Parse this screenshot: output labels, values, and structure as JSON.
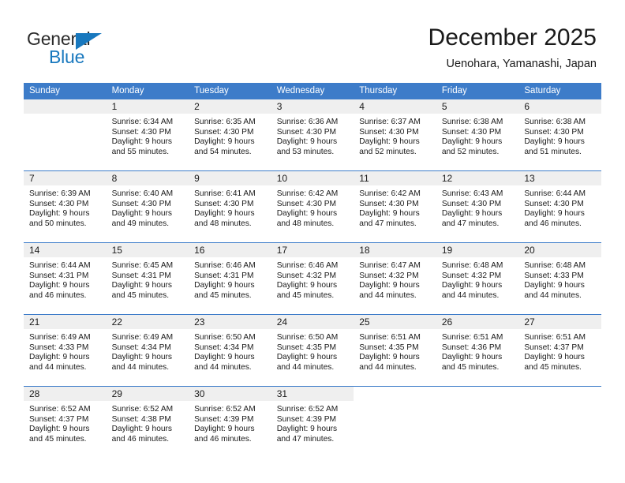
{
  "branding": {
    "logo_primary": "General",
    "logo_secondary": "Blue",
    "logo_triangle_color": "#1878be",
    "logo_primary_color": "#2b2b2b"
  },
  "header": {
    "title": "December 2025",
    "subtitle": "Uenohara, Yamanashi, Japan"
  },
  "theme": {
    "header_row_background": "#3d7cc9",
    "day_number_band_background": "#efefef",
    "grid_line_color": "#3d7cc9",
    "text_color": "#1a1a1a"
  },
  "calendar": {
    "weekday_headers": [
      "Sunday",
      "Monday",
      "Tuesday",
      "Wednesday",
      "Thursday",
      "Friday",
      "Saturday"
    ],
    "weeks": [
      [
        {
          "day": "",
          "lines": [],
          "blank": true,
          "leading_shade": true
        },
        {
          "day": "1",
          "lines": [
            "Sunrise: 6:34 AM",
            "Sunset: 4:30 PM",
            "Daylight: 9 hours",
            "and 55 minutes."
          ]
        },
        {
          "day": "2",
          "lines": [
            "Sunrise: 6:35 AM",
            "Sunset: 4:30 PM",
            "Daylight: 9 hours",
            "and 54 minutes."
          ]
        },
        {
          "day": "3",
          "lines": [
            "Sunrise: 6:36 AM",
            "Sunset: 4:30 PM",
            "Daylight: 9 hours",
            "and 53 minutes."
          ]
        },
        {
          "day": "4",
          "lines": [
            "Sunrise: 6:37 AM",
            "Sunset: 4:30 PM",
            "Daylight: 9 hours",
            "and 52 minutes."
          ]
        },
        {
          "day": "5",
          "lines": [
            "Sunrise: 6:38 AM",
            "Sunset: 4:30 PM",
            "Daylight: 9 hours",
            "and 52 minutes."
          ]
        },
        {
          "day": "6",
          "lines": [
            "Sunrise: 6:38 AM",
            "Sunset: 4:30 PM",
            "Daylight: 9 hours",
            "and 51 minutes."
          ]
        }
      ],
      [
        {
          "day": "7",
          "lines": [
            "Sunrise: 6:39 AM",
            "Sunset: 4:30 PM",
            "Daylight: 9 hours",
            "and 50 minutes."
          ]
        },
        {
          "day": "8",
          "lines": [
            "Sunrise: 6:40 AM",
            "Sunset: 4:30 PM",
            "Daylight: 9 hours",
            "and 49 minutes."
          ]
        },
        {
          "day": "9",
          "lines": [
            "Sunrise: 6:41 AM",
            "Sunset: 4:30 PM",
            "Daylight: 9 hours",
            "and 48 minutes."
          ]
        },
        {
          "day": "10",
          "lines": [
            "Sunrise: 6:42 AM",
            "Sunset: 4:30 PM",
            "Daylight: 9 hours",
            "and 48 minutes."
          ]
        },
        {
          "day": "11",
          "lines": [
            "Sunrise: 6:42 AM",
            "Sunset: 4:30 PM",
            "Daylight: 9 hours",
            "and 47 minutes."
          ]
        },
        {
          "day": "12",
          "lines": [
            "Sunrise: 6:43 AM",
            "Sunset: 4:30 PM",
            "Daylight: 9 hours",
            "and 47 minutes."
          ]
        },
        {
          "day": "13",
          "lines": [
            "Sunrise: 6:44 AM",
            "Sunset: 4:30 PM",
            "Daylight: 9 hours",
            "and 46 minutes."
          ]
        }
      ],
      [
        {
          "day": "14",
          "lines": [
            "Sunrise: 6:44 AM",
            "Sunset: 4:31 PM",
            "Daylight: 9 hours",
            "and 46 minutes."
          ]
        },
        {
          "day": "15",
          "lines": [
            "Sunrise: 6:45 AM",
            "Sunset: 4:31 PM",
            "Daylight: 9 hours",
            "and 45 minutes."
          ]
        },
        {
          "day": "16",
          "lines": [
            "Sunrise: 6:46 AM",
            "Sunset: 4:31 PM",
            "Daylight: 9 hours",
            "and 45 minutes."
          ]
        },
        {
          "day": "17",
          "lines": [
            "Sunrise: 6:46 AM",
            "Sunset: 4:32 PM",
            "Daylight: 9 hours",
            "and 45 minutes."
          ]
        },
        {
          "day": "18",
          "lines": [
            "Sunrise: 6:47 AM",
            "Sunset: 4:32 PM",
            "Daylight: 9 hours",
            "and 44 minutes."
          ]
        },
        {
          "day": "19",
          "lines": [
            "Sunrise: 6:48 AM",
            "Sunset: 4:32 PM",
            "Daylight: 9 hours",
            "and 44 minutes."
          ]
        },
        {
          "day": "20",
          "lines": [
            "Sunrise: 6:48 AM",
            "Sunset: 4:33 PM",
            "Daylight: 9 hours",
            "and 44 minutes."
          ]
        }
      ],
      [
        {
          "day": "21",
          "lines": [
            "Sunrise: 6:49 AM",
            "Sunset: 4:33 PM",
            "Daylight: 9 hours",
            "and 44 minutes."
          ]
        },
        {
          "day": "22",
          "lines": [
            "Sunrise: 6:49 AM",
            "Sunset: 4:34 PM",
            "Daylight: 9 hours",
            "and 44 minutes."
          ]
        },
        {
          "day": "23",
          "lines": [
            "Sunrise: 6:50 AM",
            "Sunset: 4:34 PM",
            "Daylight: 9 hours",
            "and 44 minutes."
          ]
        },
        {
          "day": "24",
          "lines": [
            "Sunrise: 6:50 AM",
            "Sunset: 4:35 PM",
            "Daylight: 9 hours",
            "and 44 minutes."
          ]
        },
        {
          "day": "25",
          "lines": [
            "Sunrise: 6:51 AM",
            "Sunset: 4:35 PM",
            "Daylight: 9 hours",
            "and 44 minutes."
          ]
        },
        {
          "day": "26",
          "lines": [
            "Sunrise: 6:51 AM",
            "Sunset: 4:36 PM",
            "Daylight: 9 hours",
            "and 45 minutes."
          ]
        },
        {
          "day": "27",
          "lines": [
            "Sunrise: 6:51 AM",
            "Sunset: 4:37 PM",
            "Daylight: 9 hours",
            "and 45 minutes."
          ]
        }
      ],
      [
        {
          "day": "28",
          "lines": [
            "Sunrise: 6:52 AM",
            "Sunset: 4:37 PM",
            "Daylight: 9 hours",
            "and 45 minutes."
          ]
        },
        {
          "day": "29",
          "lines": [
            "Sunrise: 6:52 AM",
            "Sunset: 4:38 PM",
            "Daylight: 9 hours",
            "and 46 minutes."
          ]
        },
        {
          "day": "30",
          "lines": [
            "Sunrise: 6:52 AM",
            "Sunset: 4:39 PM",
            "Daylight: 9 hours",
            "and 46 minutes."
          ]
        },
        {
          "day": "31",
          "lines": [
            "Sunrise: 6:52 AM",
            "Sunset: 4:39 PM",
            "Daylight: 9 hours",
            "and 47 minutes."
          ]
        },
        {
          "day": "",
          "lines": [],
          "blank": true
        },
        {
          "day": "",
          "lines": [],
          "blank": true
        },
        {
          "day": "",
          "lines": [],
          "blank": true
        }
      ]
    ]
  }
}
